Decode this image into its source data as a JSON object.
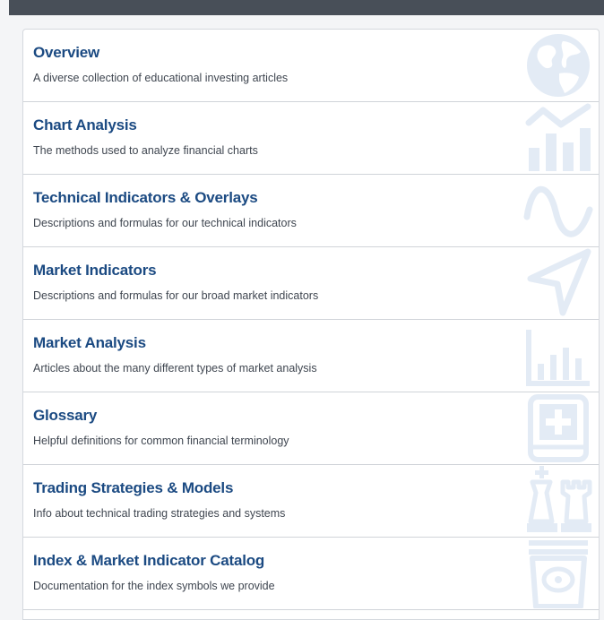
{
  "colors": {
    "title": "#1b4a82",
    "description": "#3f4650",
    "icon": "#e3ebf5",
    "top_bar": "#484f58"
  },
  "menu": {
    "items": [
      {
        "title": "Overview",
        "description": "A diverse collection of educational investing articles",
        "icon": "globe-icon"
      },
      {
        "title": "Chart Analysis",
        "description": "The methods used to analyze financial charts",
        "icon": "bar-chart-trend-icon"
      },
      {
        "title": "Technical Indicators & Overlays",
        "description": "Descriptions and formulas for our technical indicators",
        "icon": "sine-wave-icon"
      },
      {
        "title": "Market Indicators",
        "description": "Descriptions and formulas for our broad market indicators",
        "icon": "navigation-arrow-icon"
      },
      {
        "title": "Market Analysis",
        "description": "Articles about the many different types of market analysis",
        "icon": "chart-bars-icon"
      },
      {
        "title": "Glossary",
        "description": "Helpful definitions for common financial terminology",
        "icon": "medical-book-icon"
      },
      {
        "title": "Trading Strategies & Models",
        "description": "Info about technical trading strategies and systems",
        "icon": "chess-pieces-icon"
      },
      {
        "title": "Index & Market Indicator Catalog",
        "description": "Documentation for the index symbols we provide",
        "icon": "catalog-box-icon"
      }
    ]
  }
}
